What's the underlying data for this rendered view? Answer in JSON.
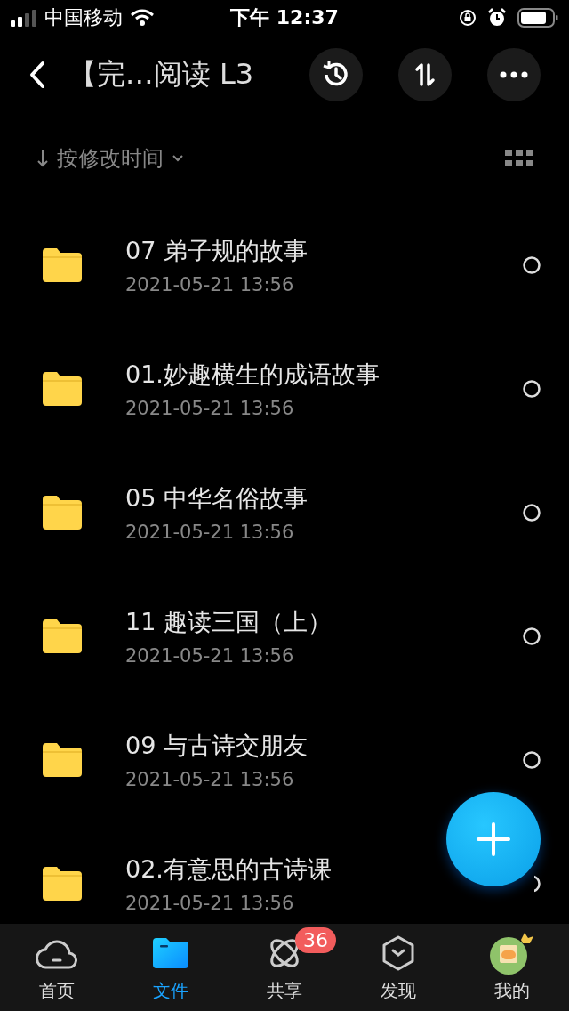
{
  "status_bar": {
    "carrier": "中国移动",
    "time": "下午 12:37"
  },
  "header": {
    "title": "【完…阅读 L3"
  },
  "sort": {
    "label": "按修改时间"
  },
  "files": [
    {
      "name": "07 弟子规的故事",
      "date": "2021-05-21 13:56",
      "selected": false
    },
    {
      "name": "01.妙趣横生的成语故事",
      "date": "2021-05-21 13:56",
      "selected": false
    },
    {
      "name": "05 中华名俗故事",
      "date": "2021-05-21 13:56",
      "selected": false
    },
    {
      "name": "11 趣读三国（上）",
      "date": "2021-05-21 13:56",
      "selected": false
    },
    {
      "name": "09 与古诗交朋友",
      "date": "2021-05-21 13:56",
      "selected": false
    },
    {
      "name": "02.有意思的古诗课",
      "date": "2021-05-21 13:56",
      "selected": false
    }
  ],
  "tab_bar": [
    {
      "kind": "cloud",
      "label": "首页",
      "selected": false
    },
    {
      "kind": "folder",
      "label": "文件",
      "selected": true
    },
    {
      "kind": "atom",
      "label": "共享",
      "selected": false,
      "badge": "36"
    },
    {
      "kind": "cube",
      "label": "发现",
      "selected": false
    },
    {
      "kind": "avatar",
      "label": "我的",
      "selected": false
    }
  ]
}
